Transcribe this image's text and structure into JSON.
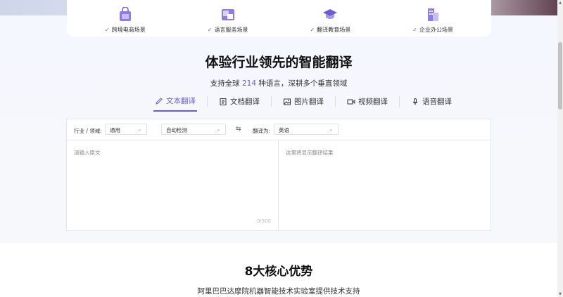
{
  "scenarios": [
    {
      "label": "跨境电商场景",
      "icon": "shopping-bag-icon"
    },
    {
      "label": "语言服务场景",
      "icon": "translate-doc-icon"
    },
    {
      "label": "翻译教育场景",
      "icon": "graduation-cap-icon"
    },
    {
      "label": "企业办公场景",
      "icon": "office-building-icon"
    }
  ],
  "hero": {
    "title": "体验行业领先的智能翻译",
    "subtitle_prefix": "支持全球",
    "subtitle_count": "214",
    "subtitle_suffix": "种语言，深耕多个垂直领域"
  },
  "tabs": [
    {
      "label": "文本翻译",
      "icon": "pencil-icon",
      "active": true
    },
    {
      "label": "文档翻译",
      "icon": "document-icon",
      "active": false
    },
    {
      "label": "图片翻译",
      "icon": "image-icon",
      "active": false
    },
    {
      "label": "视频翻译",
      "icon": "video-icon",
      "active": false
    },
    {
      "label": "语音翻译",
      "icon": "microphone-icon",
      "active": false
    }
  ],
  "toolbar": {
    "domain_label": "行业 / 领域:",
    "domain_value": "通用",
    "source_lang": "自动检测",
    "swap_symbol": "⇆",
    "target_label": "翻译为:",
    "target_lang": "英语"
  },
  "editor": {
    "source_placeholder": "请输入原文",
    "char_counter": "0/300",
    "result_placeholder": "这里将显示翻译结果"
  },
  "advantages": {
    "title": "8大核心优势",
    "subtitle": "阿里巴巴达摩院机器智能技术实验室提供技术支持"
  },
  "colors": {
    "accent": "#6d5bd0",
    "background": "#f4f7fd"
  }
}
